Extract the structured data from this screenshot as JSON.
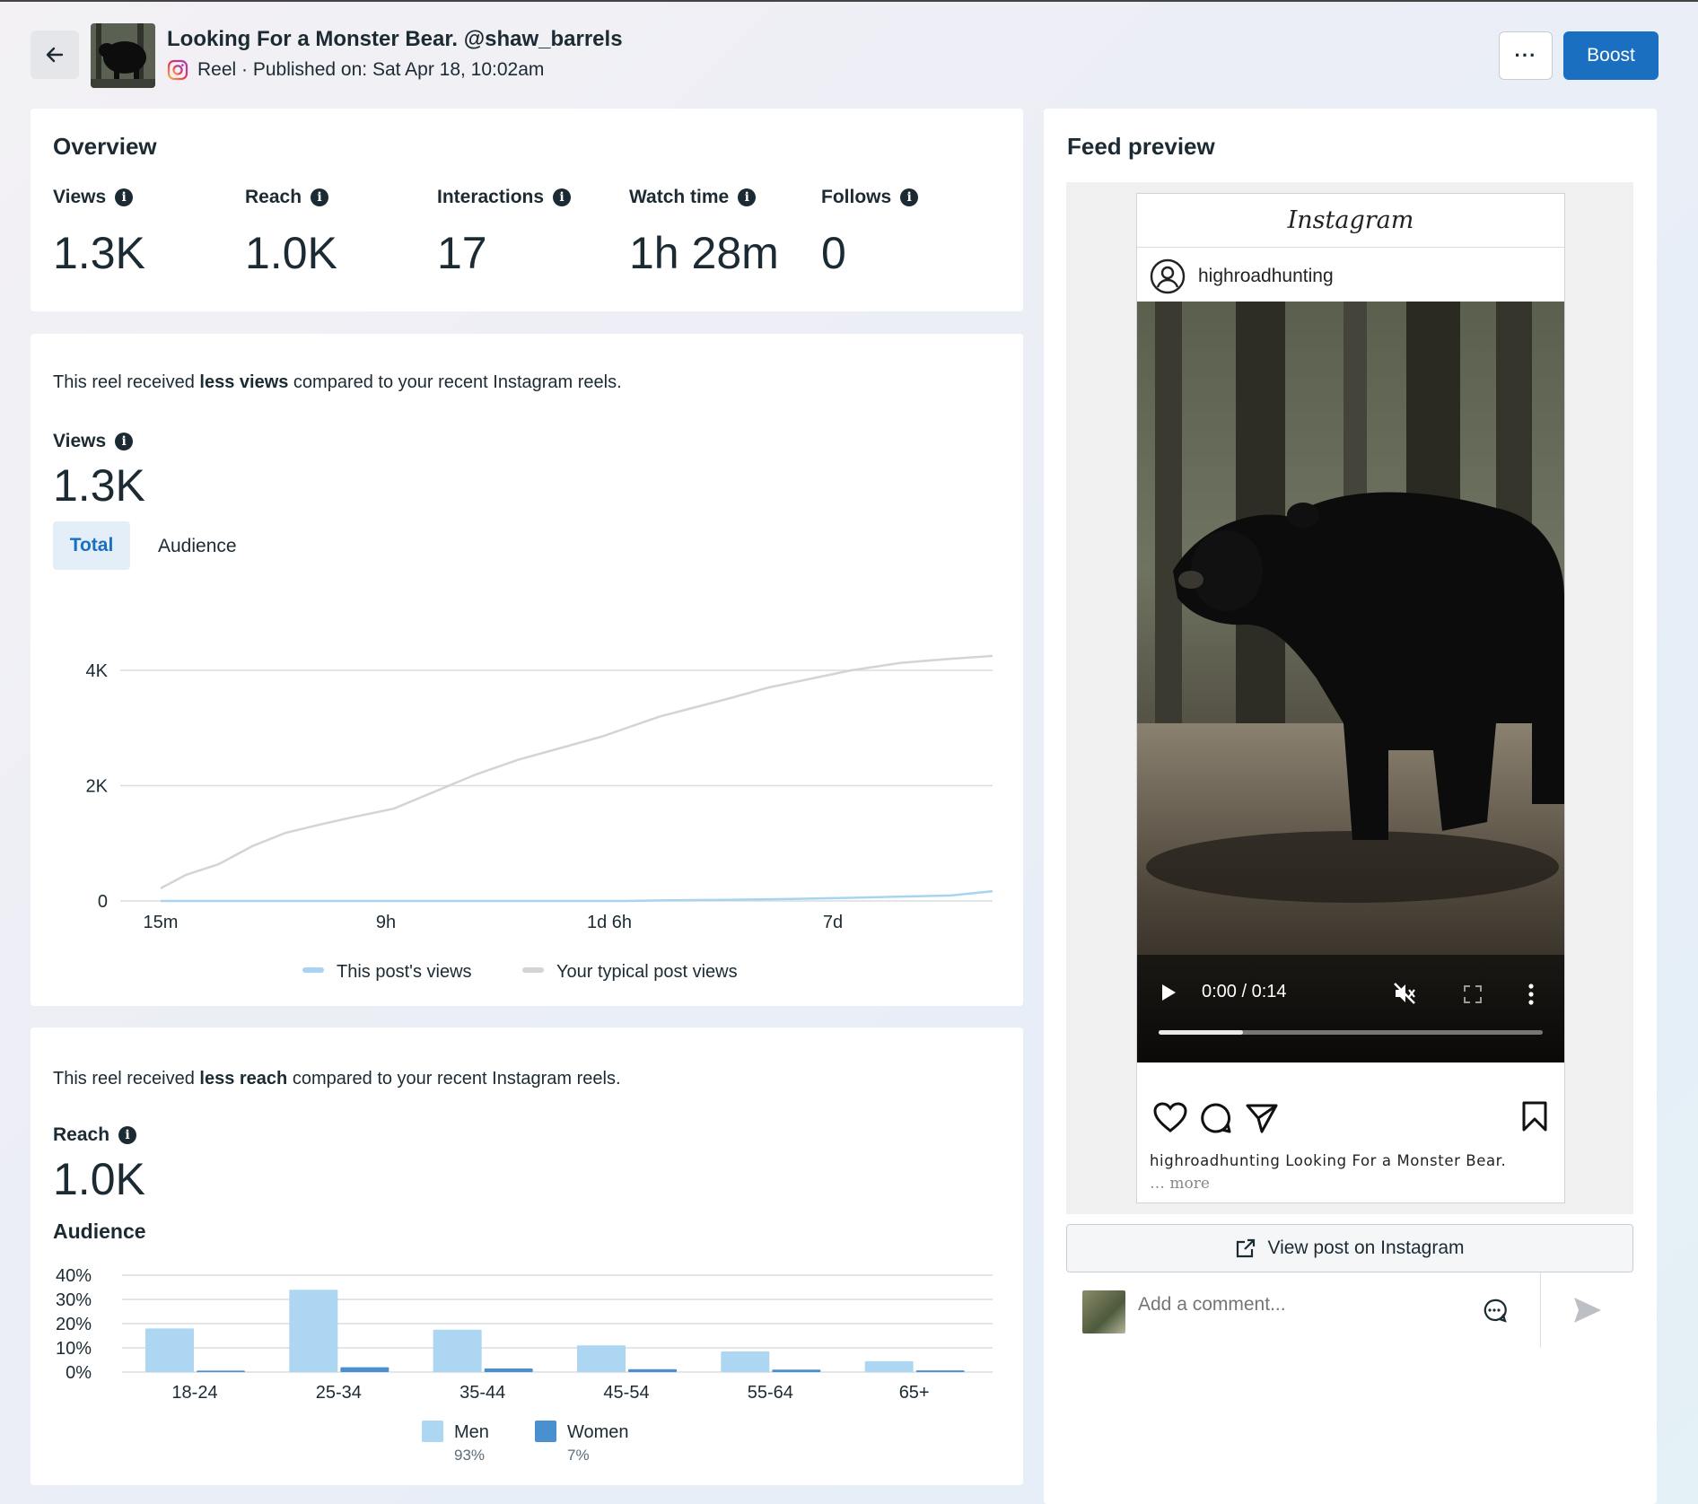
{
  "header": {
    "title": "Looking For a Monster Bear. @shaw_barrels",
    "subtitle": "Reel · Published on: Sat Apr 18, 10:02am",
    "boost_label": "Boost",
    "more_label": "···"
  },
  "overview": {
    "title": "Overview",
    "metrics": [
      {
        "label": "Views",
        "value": "1.3K"
      },
      {
        "label": "Reach",
        "value": "1.0K"
      },
      {
        "label": "Interactions",
        "value": "17"
      },
      {
        "label": "Watch time",
        "value": "1h 28m"
      },
      {
        "label": "Follows",
        "value": "0"
      }
    ]
  },
  "views_section": {
    "note_prefix": "This reel received ",
    "note_bold": "less views",
    "note_suffix": " compared to your recent Instagram reels.",
    "metric_label": "Views",
    "metric_value": "1.3K",
    "tabs": {
      "total": "Total",
      "audience": "Audience"
    }
  },
  "reach_section": {
    "note_prefix": "This reel received ",
    "note_bold": "less reach",
    "note_suffix": " compared to your recent Instagram reels.",
    "metric_label": "Reach",
    "metric_value": "1.0K",
    "audience_title": "Audience"
  },
  "chart_data": [
    {
      "type": "line",
      "x_ticks": [
        "15m",
        "9h",
        "1d 6h",
        "7d"
      ],
      "y_ticks": [
        "0",
        "2K",
        "4K"
      ],
      "ylim": [
        0,
        4000
      ],
      "grid": true,
      "legend_position": "bottom",
      "x": [
        0,
        0.03,
        0.07,
        0.11,
        0.15,
        0.19,
        0.23,
        0.28,
        0.33,
        0.38,
        0.43,
        0.48,
        0.53,
        0.56,
        0.6,
        0.64,
        0.68,
        0.73,
        0.78,
        0.83,
        0.89,
        0.95,
        1.0
      ],
      "series": [
        {
          "name": "This post's views",
          "color": "#a8d4f2",
          "values": [
            0,
            0,
            0,
            0,
            0,
            0,
            0,
            0,
            0,
            0,
            0,
            0,
            0,
            0,
            10,
            15,
            20,
            30,
            40,
            55,
            75,
            95,
            170
          ]
        },
        {
          "name": "Your typical post views",
          "color": "#d4d4d4",
          "values": [
            220,
            450,
            640,
            950,
            1180,
            1320,
            1450,
            1600,
            1900,
            2200,
            2450,
            2650,
            2850,
            3000,
            3200,
            3350,
            3500,
            3700,
            3850,
            4000,
            4130,
            4200,
            4250
          ]
        }
      ]
    },
    {
      "type": "bar",
      "categories": [
        "18-24",
        "25-34",
        "35-44",
        "45-54",
        "55-64",
        "65+"
      ],
      "ylim": [
        0,
        40
      ],
      "y_ticks": [
        "0%",
        "10%",
        "20%",
        "30%",
        "40%"
      ],
      "grid": true,
      "legend_position": "bottom",
      "series": [
        {
          "name": "Men",
          "share": "93%",
          "color": "#acd6f1",
          "values": [
            18,
            34,
            17.5,
            11,
            8.5,
            4.5
          ]
        },
        {
          "name": "Women",
          "share": "7%",
          "color": "#4a8fcf",
          "values": [
            0.6,
            2,
            1.5,
            1.2,
            1,
            0.7
          ]
        }
      ]
    }
  ],
  "feed_preview": {
    "title": "Feed preview",
    "brand": "Instagram",
    "username": "highroadhunting",
    "video_time": "0:00 / 0:14",
    "video_progress": 0.22,
    "caption": "highroadhunting Looking For a Monster Bear.",
    "caption_more": "… more",
    "view_button": "View post on Instagram",
    "comment_placeholder": "Add a comment..."
  }
}
